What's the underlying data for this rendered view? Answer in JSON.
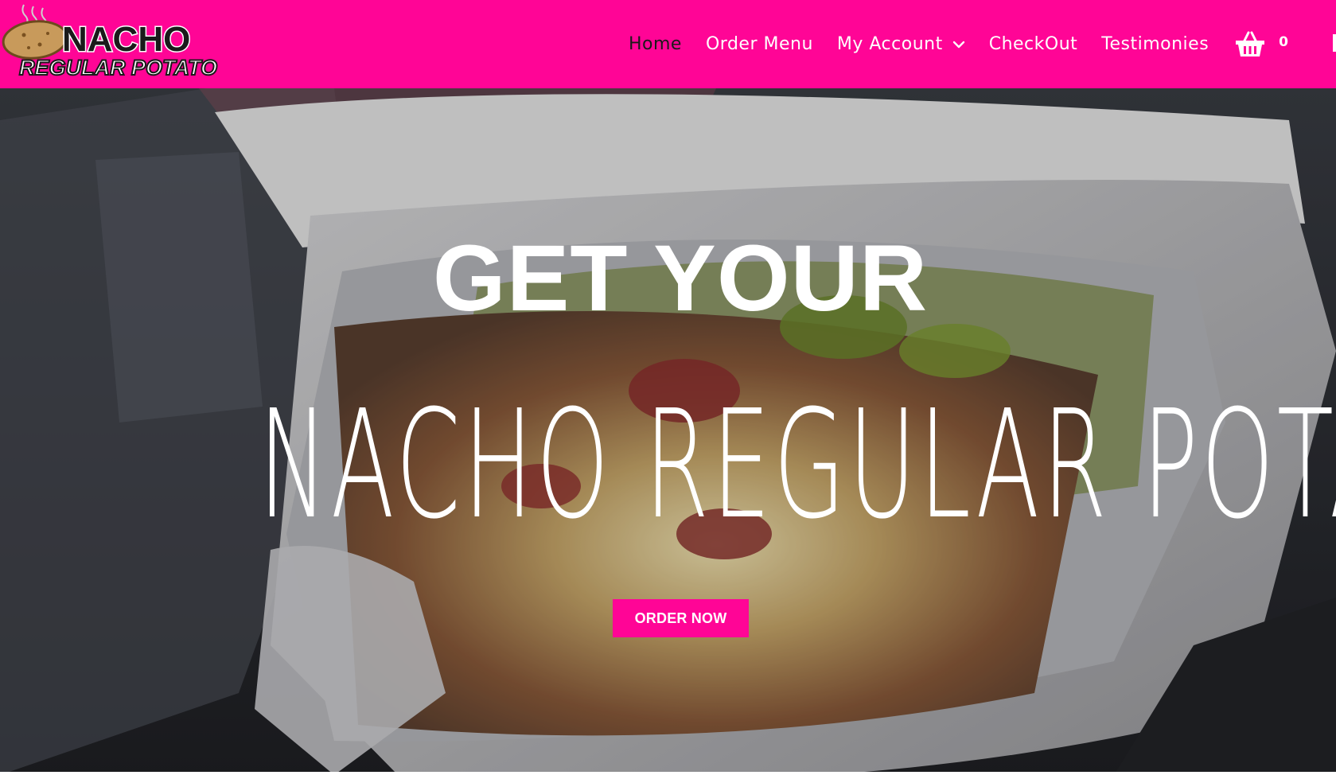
{
  "brand": {
    "logo_line1": "NACHO",
    "logo_line2": "REGULAR POTATO"
  },
  "nav": {
    "items": [
      {
        "label": "Home",
        "active": true
      },
      {
        "label": "Order Menu"
      },
      {
        "label": "My Account",
        "has_dropdown": true
      },
      {
        "label": "CheckOut"
      },
      {
        "label": "Testimonies"
      }
    ],
    "cart_count": "0"
  },
  "hero": {
    "headline": "GET YOUR",
    "brand_text": "NACHO REGULAR POTATO",
    "button_label": "ORDER NOW"
  },
  "colors": {
    "brand_pink": "#ff0596",
    "text_white": "#ffffff",
    "nav_active": "#1a1a1a"
  },
  "icons": {
    "cart": "shopping-basket-icon",
    "dropdown": "chevron-down-icon"
  }
}
